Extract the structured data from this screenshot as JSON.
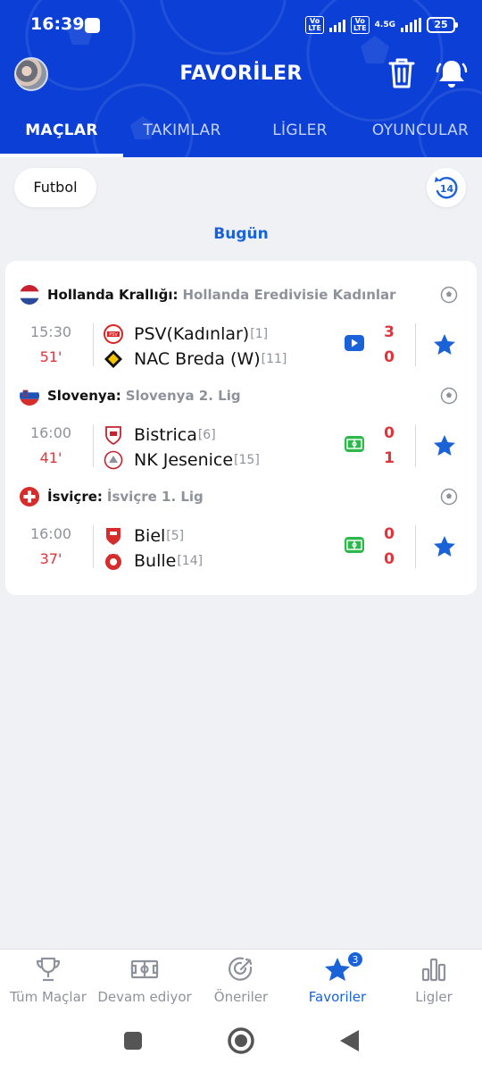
{
  "status": {
    "time": "16:39",
    "volte1": "Vo\nLTE",
    "volte2": "Vo\nLTE",
    "network": "4.5G",
    "battery": "25"
  },
  "header": {
    "title": "FAVORİLER"
  },
  "tabs": [
    {
      "label": "MAÇLAR",
      "active": true
    },
    {
      "label": "TAKIMLAR"
    },
    {
      "label": "LİGLER"
    },
    {
      "label": "OYUNCULAR"
    }
  ],
  "filter": {
    "sport": "Futbol",
    "history_days": "14"
  },
  "date_label": "Bugün",
  "leagues": [
    {
      "country": "Hollanda Krallığı:",
      "name": "Hollanda Eredivisie Kadınlar",
      "match": {
        "time": "15:30",
        "minute": "51'",
        "home": "PSV(Kadınlar)",
        "home_rank": "[1]",
        "away": "NAC Breda (W)",
        "away_rank": "[11]",
        "home_score": "3",
        "away_score": "0",
        "media": "video"
      }
    },
    {
      "country": "Slovenya:",
      "name": "Slovenya 2. Lig",
      "match": {
        "time": "16:00",
        "minute": "41'",
        "home": "Bistrica",
        "home_rank": "[6]",
        "away": "NK Jesenice",
        "away_rank": "[15]",
        "home_score": "0",
        "away_score": "1",
        "media": "field"
      }
    },
    {
      "country": "İsviçre:",
      "name": "İsviçre 1. Lig",
      "match": {
        "time": "16:00",
        "minute": "37'",
        "home": "Biel",
        "home_rank": "[5]",
        "away": "Bulle",
        "away_rank": "[14]",
        "home_score": "0",
        "away_score": "0",
        "media": "field"
      }
    }
  ],
  "bottom_nav": [
    {
      "label": "Tüm Maçlar",
      "icon": "trophy-icon"
    },
    {
      "label": "Devam ediyor",
      "icon": "pitch-icon"
    },
    {
      "label": "Öneriler",
      "icon": "target-icon"
    },
    {
      "label": "Favoriler",
      "icon": "star-icon",
      "active": true,
      "badge": "3"
    },
    {
      "label": "Ligler",
      "icon": "bar-chart-icon"
    }
  ],
  "colors": {
    "primary": "#0b3fd6",
    "accent": "#1a62d8",
    "live": "#e0343c",
    "muted": "#8e939b",
    "field": "#2db84c"
  }
}
